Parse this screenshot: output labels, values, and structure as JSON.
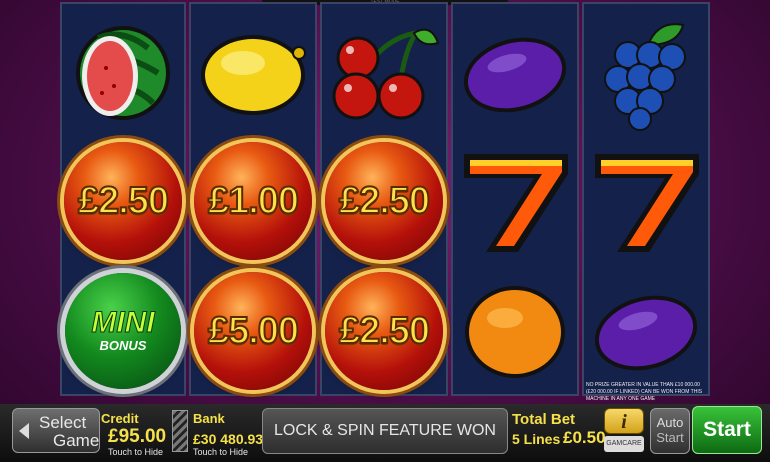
{
  "top_bar": {
    "label": "TEST MODE"
  },
  "reels": [
    {
      "symbols": [
        {
          "kind": "symbol",
          "icon": "watermelon-icon"
        },
        {
          "kind": "coin",
          "value": "£2.50"
        },
        {
          "kind": "mini",
          "line1": "MINI",
          "line2": "BONUS"
        }
      ]
    },
    {
      "symbols": [
        {
          "kind": "symbol",
          "icon": "lemon-icon"
        },
        {
          "kind": "coin",
          "value": "£1.00"
        },
        {
          "kind": "coin",
          "value": "£5.00"
        }
      ]
    },
    {
      "symbols": [
        {
          "kind": "symbol",
          "icon": "cherries-icon"
        },
        {
          "kind": "coin",
          "value": "£2.50"
        },
        {
          "kind": "coin",
          "value": "£2.50"
        }
      ]
    },
    {
      "symbols": [
        {
          "kind": "symbol",
          "icon": "plum-icon"
        },
        {
          "kind": "symbol",
          "icon": "seven-icon"
        },
        {
          "kind": "symbol",
          "icon": "orange-icon"
        }
      ]
    },
    {
      "symbols": [
        {
          "kind": "symbol",
          "icon": "grapes-icon"
        },
        {
          "kind": "symbol",
          "icon": "seven-icon"
        },
        {
          "kind": "symbol",
          "icon": "plum-icon"
        }
      ]
    }
  ],
  "disclaimer": {
    "line1": "NO PRIZE GREATER IN VALUE THAN £10 000.00",
    "line2": "(£20 000.00 IF LINKED) CAN BE WON FROM THIS",
    "line3": "MACHINE IN ANY ONE GAME"
  },
  "bottom_bar": {
    "select_game": {
      "line1": "Select",
      "line2": "Game"
    },
    "credit": {
      "label": "Credit",
      "value": "£95.00",
      "hint": "Touch to Hide"
    },
    "bank": {
      "label": "Bank",
      "value": "£30 480.93",
      "hint": "Touch to Hide"
    },
    "message": "LOCK & SPIN FEATURE WON",
    "total_bet": {
      "label": "Total Bet",
      "lines": "5 Lines",
      "value": "£0.50"
    },
    "info_label": "i",
    "gamcare_label": "GAMCARE",
    "auto_start": {
      "line1": "Auto",
      "line2": "Start"
    },
    "start_label": "Start"
  },
  "colors": {
    "background": "#4a0d47",
    "accent_gold": "#f5e04a",
    "start_green": "#1a8f1f"
  }
}
